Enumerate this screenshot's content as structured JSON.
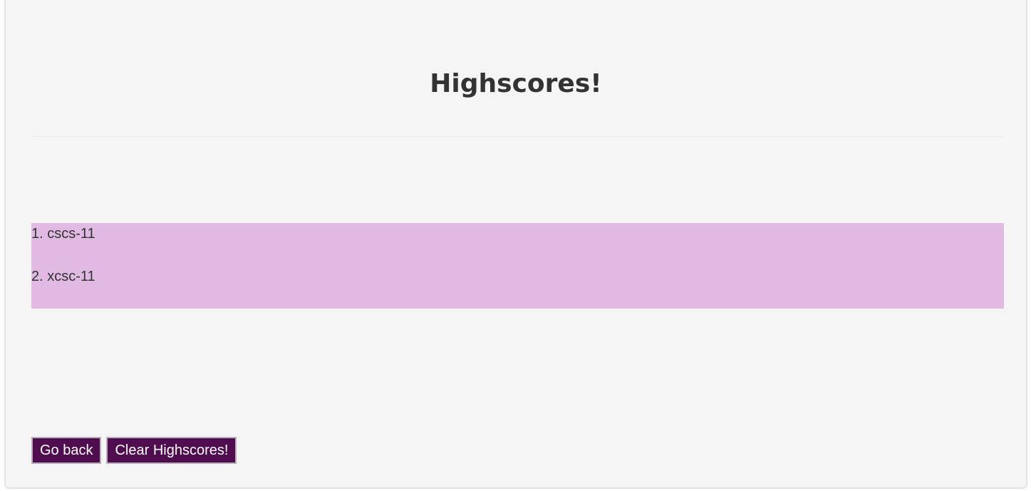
{
  "page": {
    "title": "Highscores!"
  },
  "scores": [
    {
      "label": "1. cscs-11"
    },
    {
      "label": "2. xcsc-11"
    }
  ],
  "buttons": {
    "go_back": "Go back",
    "clear": "Clear Highscores!"
  },
  "colors": {
    "background": "#f5f5f5",
    "list_background": "#e1bae3",
    "button": "#4f0d4f",
    "button_text": "#ffffff",
    "text": "#333333"
  }
}
